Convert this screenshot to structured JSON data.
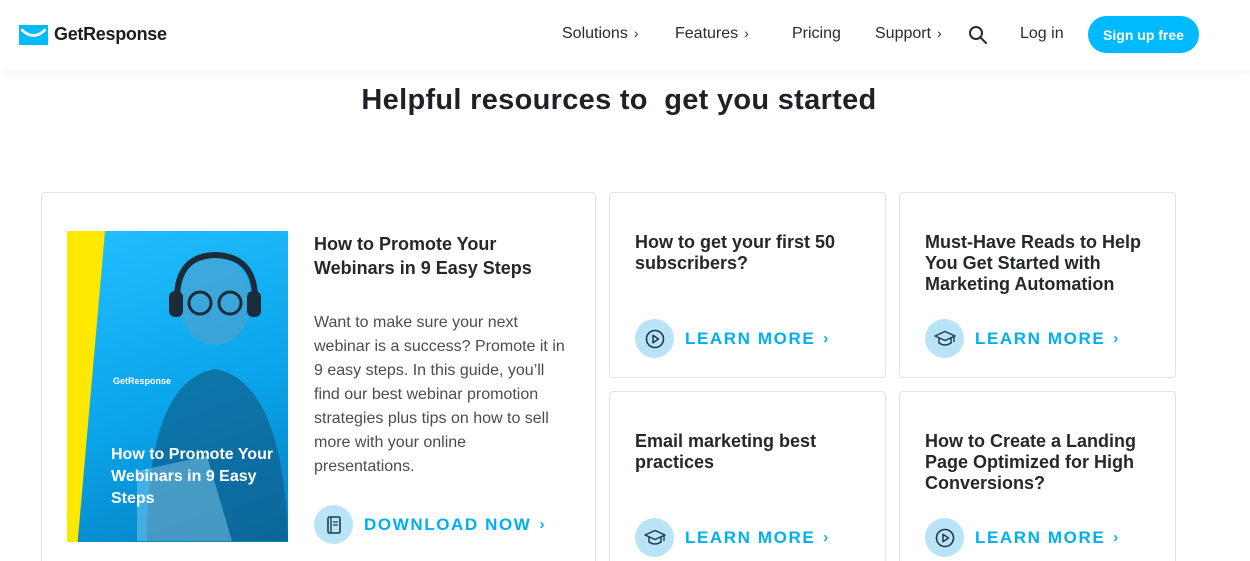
{
  "header": {
    "logo_text": "GetResponse",
    "nav": [
      {
        "label": "Solutions",
        "chevron": "›"
      },
      {
        "label": "Features",
        "chevron": "›"
      },
      {
        "label": "Pricing",
        "chevron": ""
      },
      {
        "label": "Support",
        "chevron": "›"
      }
    ],
    "login_label": "Log in",
    "signup_label": "Sign up free"
  },
  "heading": {
    "text": "Helpful resources to",
    "highlight": "get you started",
    "highlight_color": "#fff200"
  },
  "featured": {
    "cover_logo": "GetResponse",
    "cover_title": "How to Promote Your Webinars in 9 Easy Steps",
    "title": "How to Promote Your Webinars in 9 Easy Steps",
    "description": "Want to make sure your next webinar is a success? Promote it in 9 easy steps. In this guide, you’ll find our best webinar promotion strategies plus tips on how to sell more with your online presentations.",
    "cta_label": "DOWNLOAD NOW",
    "cta_icon": "book-icon"
  },
  "resources": [
    {
      "title": "How to get your first 50 subscribers?",
      "cta_label": "LEARN MORE",
      "icon": "play-icon"
    },
    {
      "title": "Must-Have Reads to Help You Get Started with Marketing Automation",
      "cta_label": "LEARN MORE",
      "icon": "graduation-cap-icon"
    },
    {
      "title": "Email marketing best practices",
      "cta_label": "LEARN MORE",
      "icon": "graduation-cap-icon"
    },
    {
      "title": "How to Create a Landing Page Optimized for High Conversions?",
      "cta_label": "LEARN MORE",
      "icon": "play-icon"
    }
  ],
  "cta_chevron": "›",
  "colors": {
    "accent": "#00aff0",
    "button": "#00baff",
    "icon_bg": "#b9e4f7"
  }
}
